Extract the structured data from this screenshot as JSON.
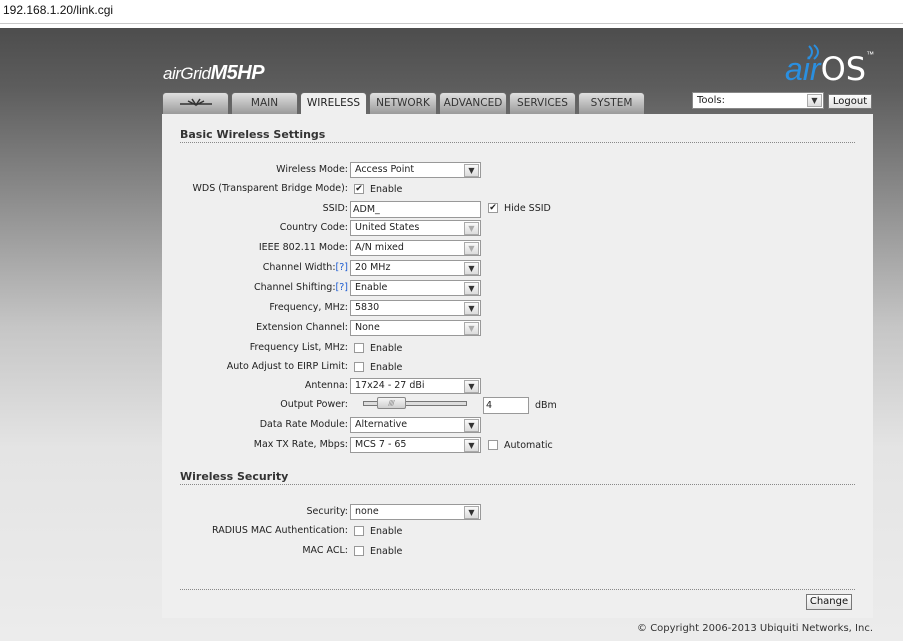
{
  "browser": {
    "url": "192.168.1.20/link.cgi"
  },
  "header": {
    "product_prefix": "airGrid",
    "product_model": "M5HP",
    "airos_air": "air",
    "airos_os": "OS",
    "airos_tm": "™"
  },
  "tabs": [
    {
      "label": "",
      "icon": "ubiquiti-logo-icon"
    },
    {
      "label": "MAIN"
    },
    {
      "label": "WIRELESS",
      "active": true
    },
    {
      "label": "NETWORK"
    },
    {
      "label": "ADVANCED"
    },
    {
      "label": "SERVICES"
    },
    {
      "label": "SYSTEM"
    }
  ],
  "toolbar": {
    "tools_value": "Tools:",
    "logout_label": "Logout"
  },
  "basic": {
    "title": "Basic Wireless Settings",
    "wireless_mode_label": "Wireless Mode:",
    "wireless_mode_value": "Access Point",
    "wds_label": "WDS (Transparent Bridge Mode):",
    "wds_enable_label": "Enable",
    "wds_checked": true,
    "ssid_label": "SSID:",
    "ssid_value": "ADM_",
    "hide_ssid_label": "Hide SSID",
    "hide_ssid_checked": true,
    "country_label": "Country Code:",
    "country_value": "United States",
    "ieee_label": "IEEE 802.11 Mode:",
    "ieee_value": "A/N mixed",
    "channel_width_label": "Channel Width:",
    "channel_width_help": "[?]",
    "channel_width_value": "20 MHz",
    "channel_shifting_label": "Channel Shifting:",
    "channel_shifting_help": "[?]",
    "channel_shifting_value": "Enable",
    "frequency_label": "Frequency, MHz:",
    "frequency_value": "5830",
    "extension_label": "Extension Channel:",
    "extension_value": "None",
    "freq_list_label": "Frequency List, MHz:",
    "freq_list_enable": "Enable",
    "auto_eirp_label": "Auto Adjust to EIRP Limit:",
    "auto_eirp_enable": "Enable",
    "antenna_label": "Antenna:",
    "antenna_value": "17x24 - 27 dBi",
    "output_power_label": "Output Power:",
    "output_power_value": "4",
    "output_power_unit": "dBm",
    "output_power_fraction": 0.18,
    "data_rate_label": "Data Rate Module:",
    "data_rate_value": "Alternative",
    "max_tx_label": "Max TX Rate, Mbps:",
    "max_tx_value": "MCS 7 - 65",
    "automatic_label": "Automatic"
  },
  "security": {
    "title": "Wireless Security",
    "security_label": "Security:",
    "security_value": "none",
    "radius_label": "RADIUS MAC Authentication:",
    "radius_enable": "Enable",
    "mac_acl_label": "MAC ACL:",
    "mac_acl_enable": "Enable"
  },
  "footer": {
    "change_label": "Change",
    "copyright": "© Copyright 2006-2013 Ubiquiti Networks, Inc."
  }
}
